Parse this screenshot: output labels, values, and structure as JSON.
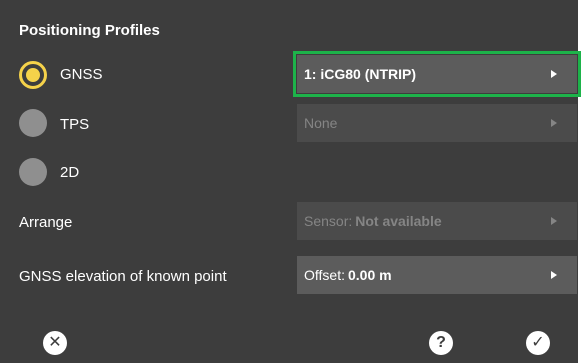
{
  "title": "Positioning Profiles",
  "options": [
    {
      "label": "GNSS",
      "selected": true
    },
    {
      "label": "TPS",
      "selected": false
    },
    {
      "label": "2D",
      "selected": false
    }
  ],
  "fields": {
    "gnss": {
      "value": "1: iCG80 (NTRIP)",
      "enabled": true
    },
    "tps": {
      "value": "None",
      "enabled": false
    },
    "arrange": {
      "label": "Arrange",
      "prefix": "Sensor:",
      "value": "Not available",
      "enabled": false
    },
    "elevation": {
      "label": "GNSS elevation of known point",
      "prefix": "Offset:",
      "value": "0.00 m",
      "enabled": true
    }
  },
  "buttons": {
    "close_icon": "✕",
    "help_icon": "?",
    "confirm_icon": "✓"
  },
  "colors": {
    "panel_bg": "#3d3d3d",
    "selected_radio": "#f5d24a",
    "highlight_border": "#1db34a"
  }
}
